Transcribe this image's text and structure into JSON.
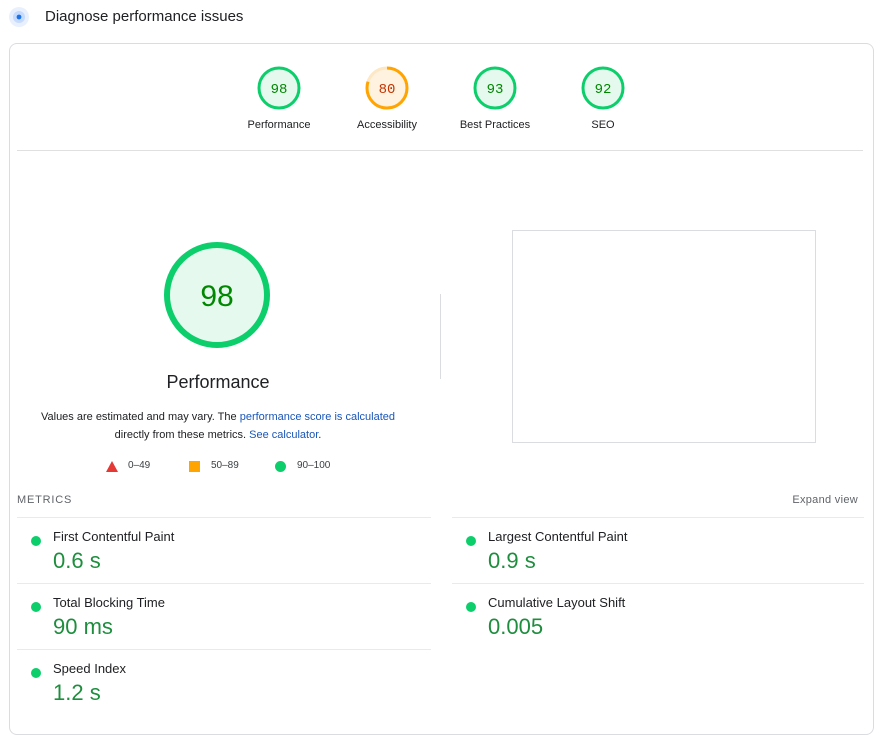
{
  "header": {
    "title": "Diagnose performance issues",
    "icon": "lighthouse-icon"
  },
  "categories": [
    {
      "label": "Performance",
      "score": "98",
      "status": "pass"
    },
    {
      "label": "Accessibility",
      "score": "80",
      "status": "average"
    },
    {
      "label": "Best Practices",
      "score": "93",
      "status": "pass"
    },
    {
      "label": "SEO",
      "score": "92",
      "status": "pass"
    }
  ],
  "performance": {
    "score": "98",
    "title": "Performance",
    "desc_prefix": "Values are estimated and may vary. The ",
    "desc_link": "performance score is calculated",
    "desc_mid": "directly from these metrics. ",
    "desc_link2": "See calculator",
    "desc_suffix": "."
  },
  "legend": [
    {
      "range": "0–49",
      "shape": "triangle",
      "color": "#e53935"
    },
    {
      "range": "50–89",
      "shape": "square",
      "color": "#ffa400"
    },
    {
      "range": "90–100",
      "shape": "circle",
      "color": "#0cce6b"
    }
  ],
  "metrics_section": {
    "label": "METRICS",
    "expand_label": "Expand view"
  },
  "metrics": [
    {
      "name": "First Contentful Paint",
      "value": "0.6 s"
    },
    {
      "name": "Largest Contentful Paint",
      "value": "0.9 s"
    },
    {
      "name": "Total Blocking Time",
      "value": "90 ms"
    },
    {
      "name": "Cumulative Layout Shift",
      "value": "0.005"
    },
    {
      "name": "Speed Index",
      "value": "1.2 s"
    }
  ],
  "colors": {
    "pass": "#0cce6b",
    "pass_text": "#008800",
    "pass_fill": "#e6f9ee",
    "average": "#ffa400",
    "average_text": "#c33300",
    "average_fill": "#fff3e0",
    "link": "#1a56b7"
  }
}
